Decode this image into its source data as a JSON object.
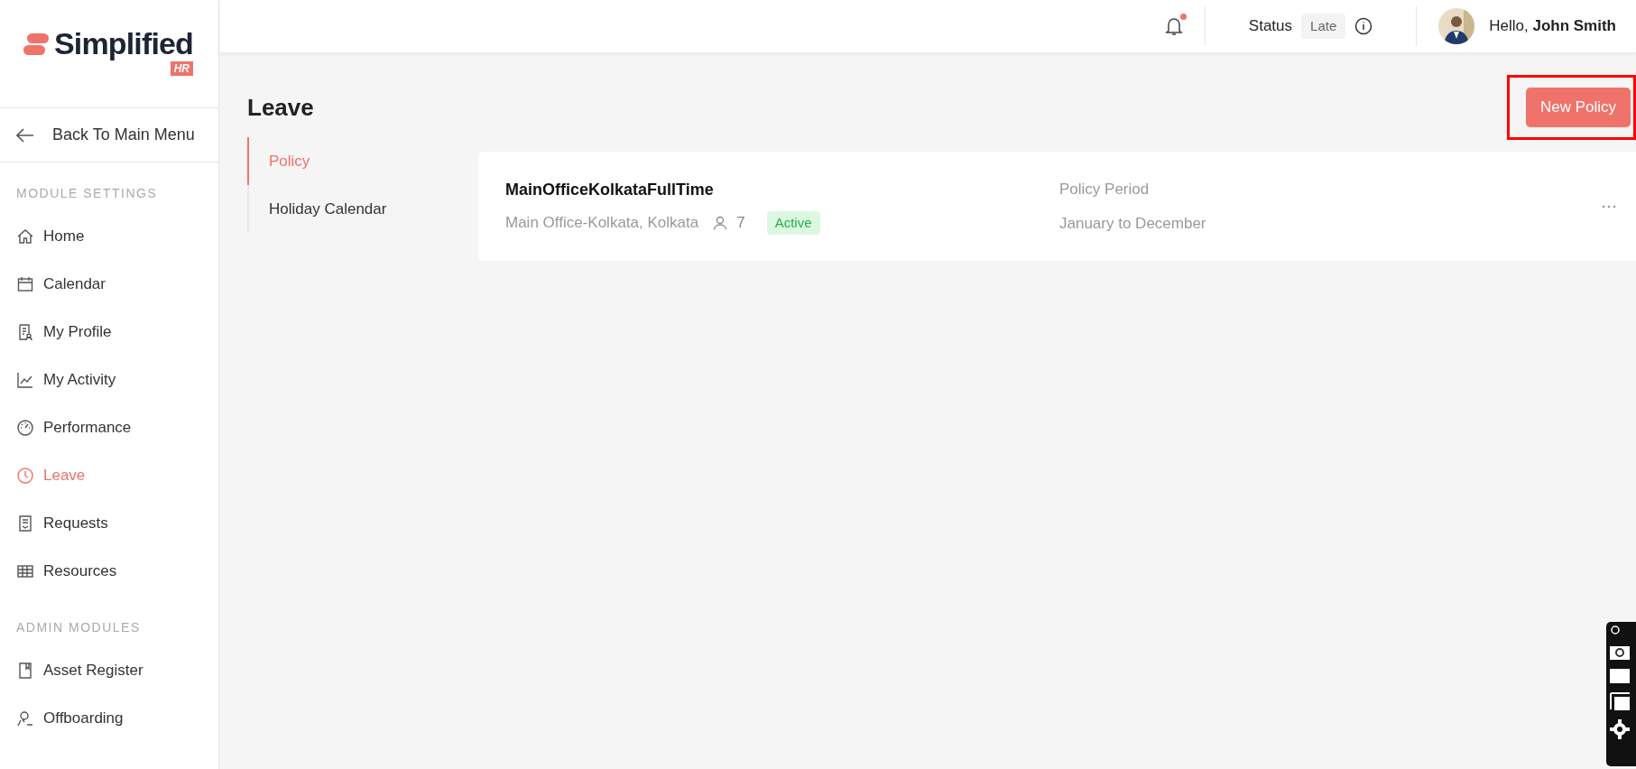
{
  "logo": {
    "name": "Simplified",
    "badge": "HR"
  },
  "back_link": "Back To Main Menu",
  "sidebar": [
    {
      "heading": "MODULE SETTINGS",
      "items": [
        {
          "label": "Home",
          "selected": false
        },
        {
          "label": "Calendar",
          "selected": false
        },
        {
          "label": "My Profile",
          "selected": false
        },
        {
          "label": "My Activity",
          "selected": false
        },
        {
          "label": "Performance",
          "selected": false
        },
        {
          "label": "Leave",
          "selected": true
        },
        {
          "label": "Requests",
          "selected": false
        },
        {
          "label": "Resources",
          "selected": false
        }
      ]
    },
    {
      "heading": "ADMIN MODULES",
      "items": [
        {
          "label": "Asset Register",
          "selected": false
        },
        {
          "label": "Offboarding",
          "selected": false
        }
      ]
    }
  ],
  "top_bar": {
    "notification": true,
    "status_label": "Status",
    "status_value": "Late",
    "greeting": "Hello, **John Smith**"
  },
  "page_title": "Leave",
  "primary_button": "New Policy",
  "tabs": [
    {
      "label": "Policy",
      "selected": true
    },
    {
      "label": "Holiday Calendar",
      "selected": false
    }
  ],
  "policies": [
    {
      "name": "MainOfficeKolkataFullTime",
      "location": "Main Office-Kolkata, Kolkata",
      "members": "7",
      "status": "Active",
      "period_label": "Policy Period",
      "period": "January to December"
    }
  ]
}
